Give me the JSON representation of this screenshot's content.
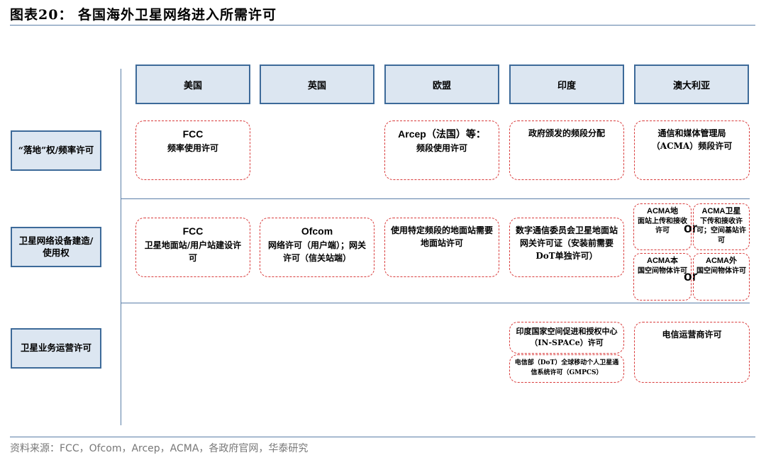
{
  "title": "图表20： 各国海外卫星网络进入所需许可",
  "columns": [
    "美国",
    "英国",
    "欧盟",
    "印度",
    "澳大利亚"
  ],
  "rows": [
    "“落地”权/频率许可",
    "卫星网络设备建造/使用权",
    "卫星业务运营许可"
  ],
  "cells": {
    "us_r1": {
      "head": "FCC",
      "text": "频率使用许可"
    },
    "eu_r1": {
      "head": "Arcep（法国）等：",
      "text": "频段使用许可"
    },
    "in_r1": {
      "text": "政府颁发的频段分配"
    },
    "au_r1": {
      "text": "通信和媒体管理局（ACMA）频段许可"
    },
    "us_r2": {
      "head": "FCC",
      "text": "卫星地面站/用户站建设许可"
    },
    "uk_r2": {
      "head": "Ofcom",
      "text": "网络许可（用户端）；网关许可（信关站端）"
    },
    "eu_r2": {
      "text": "使用特定频段的地面站需要地面站许可"
    },
    "in_r2": {
      "text": "数字通信委员会卫星地面站网关许可证（安装前需要DoT单独许可）"
    },
    "au_r2_a": {
      "head": "ACMA地",
      "text": "面站上传和接收许可"
    },
    "au_r2_b": {
      "head": "ACMA卫星",
      "text": "下传和接收许可；空间基站许可"
    },
    "au_r2_c": {
      "head": "ACMA本",
      "text": "国空间物体许可"
    },
    "au_r2_d": {
      "head": "ACMA外",
      "text": "国空间物体许可"
    },
    "in_r3_a": {
      "text": "印度国家空间促进和授权中心（IN-SPACe）许可"
    },
    "in_r3_b": {
      "text": "电信部（DoT）全球移动个人卫星通信系统许可（GMPCS）"
    },
    "au_r3": {
      "text": "电信运营商许可"
    }
  },
  "or_label": "or",
  "source": "资料来源：FCC，Ofcom，Arcep，ACMA，各政府官网，华泰研究"
}
